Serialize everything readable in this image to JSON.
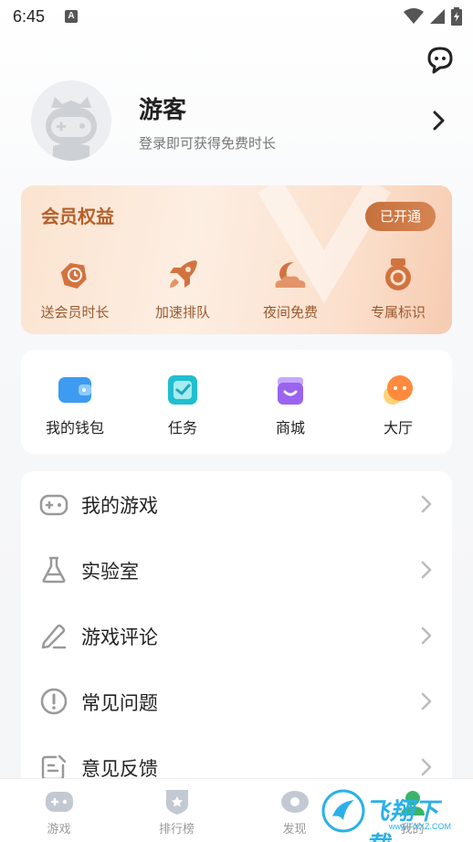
{
  "status_bar": {
    "time": "6:45",
    "notif_letter": "A"
  },
  "profile": {
    "name": "游客",
    "hint": "登录即可获得免费时长"
  },
  "vip": {
    "title": "会员权益",
    "status": "已开通",
    "items": [
      {
        "label": "送会员时长",
        "icon": "gift-tag-icon"
      },
      {
        "label": "加速排队",
        "icon": "rocket-icon"
      },
      {
        "label": "夜间免费",
        "icon": "moon-cloud-icon"
      },
      {
        "label": "专属标识",
        "icon": "badge-icon"
      }
    ]
  },
  "quick": [
    {
      "label": "我的钱包",
      "icon": "wallet-icon"
    },
    {
      "label": "任务",
      "icon": "task-icon"
    },
    {
      "label": "商城",
      "icon": "shop-icon"
    },
    {
      "label": "大厅",
      "icon": "chat-hall-icon"
    }
  ],
  "menu": [
    {
      "label": "我的游戏",
      "icon": "gamepad-icon"
    },
    {
      "label": "实验室",
      "icon": "flask-icon"
    },
    {
      "label": "游戏评论",
      "icon": "pencil-icon"
    },
    {
      "label": "常见问题",
      "icon": "exclamation-icon"
    },
    {
      "label": "意见反馈",
      "icon": "feedback-icon"
    }
  ],
  "bottom_nav": [
    {
      "label": "游戏",
      "icon": "game-icon"
    },
    {
      "label": "排行榜",
      "icon": "rank-shield-icon"
    },
    {
      "label": "发现",
      "icon": "eye-icon"
    },
    {
      "label": "我的",
      "icon": "profile-icon"
    }
  ],
  "watermark": {
    "text": "飞翔下载",
    "url": "www.FXXZ.COM"
  },
  "colors": {
    "vip_text": "#b5602a",
    "vip_button": "#c4713d",
    "accent": "#2bb0e8"
  }
}
